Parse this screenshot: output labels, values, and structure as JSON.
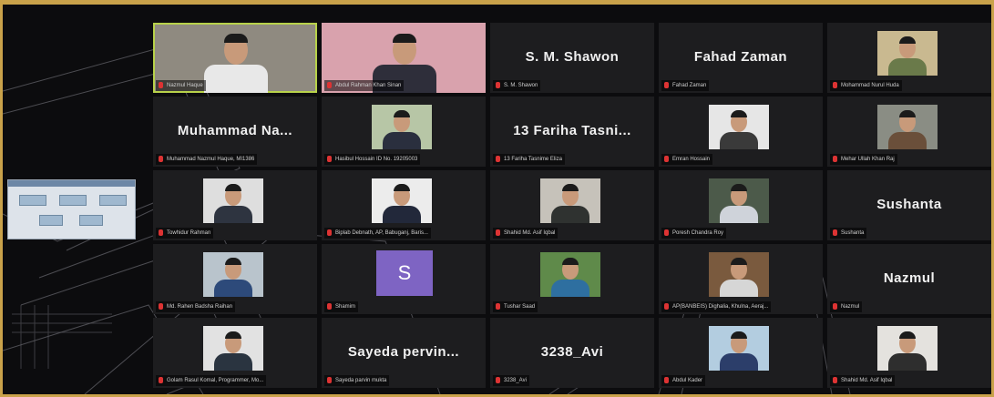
{
  "colors": {
    "frame_border": "#c9a24a",
    "background": "#0c0c0e",
    "tile": "#1d1d1f",
    "active_speaker": "#b8d24a",
    "muted": "#dd3333",
    "avatar": "#7e64c3"
  },
  "icons": {
    "mic_muted": "mic-off-icon"
  },
  "tiles": [
    {
      "kind": "video",
      "label": "Nazmul Haque",
      "bg": "#8f8a80",
      "shirt": "#e8e8e8"
    },
    {
      "kind": "video",
      "label": "Abdul Rahman Khan Sinan",
      "bg": "#d9a2ad",
      "shirt": "#2e2e3a"
    },
    {
      "kind": "name",
      "display": "S. M. Shawon",
      "label": "S. M. Shawon"
    },
    {
      "kind": "name",
      "display": "Fahad Zaman",
      "label": "Fahad Zaman"
    },
    {
      "kind": "photo",
      "label": "Mohammad Nurul Huda",
      "bg": "#c9b990",
      "shirt": "#6a7a4a"
    },
    {
      "kind": "name",
      "display": "Muhammad Na...",
      "label": "Muhammad Nazmul Haque, MI1386"
    },
    {
      "kind": "photo",
      "label": "Hasibul Hossain ID No. 19205003",
      "bg": "#b7c6a6",
      "shirt": "#2a2f3e"
    },
    {
      "kind": "name",
      "display": "13 Fariha Tasni...",
      "label": "13 Fariha Tasnime Eliza"
    },
    {
      "kind": "photo",
      "label": "Emran Hossain",
      "bg": "#e6e6e6",
      "shirt": "#3a3a3a"
    },
    {
      "kind": "photo",
      "label": "Mehar Ullah Khan Raj",
      "bg": "#8a8d84",
      "shirt": "#6a4f3a"
    },
    {
      "kind": "photo",
      "label": "Towhidur Rahman",
      "bg": "#dedede",
      "shirt": "#2e3440"
    },
    {
      "kind": "photo",
      "label": "Biplab Debnath, AP, Babuganj, Baris...",
      "bg": "#ececec",
      "shirt": "#22283a"
    },
    {
      "kind": "photo",
      "label": "Shahid Md. Asif Iqbal",
      "bg": "#c6c2ba",
      "shirt": "#2f3230"
    },
    {
      "kind": "photo",
      "label": "Poresh Chandra Roy",
      "bg": "#4c5a4a",
      "shirt": "#cfd3da"
    },
    {
      "kind": "name",
      "display": "Sushanta",
      "label": "Sushanta"
    },
    {
      "kind": "photo",
      "label": "Md. Rahen Badsha Raihan",
      "bg": "#b9c4cc",
      "shirt": "#2d4a7a"
    },
    {
      "kind": "avatar",
      "display": "S",
      "label": "Shamim"
    },
    {
      "kind": "photo",
      "label": "Tushar Saad",
      "bg": "#5f8a4a",
      "shirt": "#2e6fa0"
    },
    {
      "kind": "photo",
      "label": "AP(BANBEIS) Dighalia, Khulna, Aeraj...",
      "bg": "#7a5a3e",
      "shirt": "#d6d6d6"
    },
    {
      "kind": "name",
      "display": "Nazmul",
      "label": "Nazmul"
    },
    {
      "kind": "photo",
      "label": "Golam Rasul Komal, Programmer, Mo...",
      "bg": "#e2e2e2",
      "shirt": "#2a3440"
    },
    {
      "kind": "name",
      "display": "Sayeda pervin...",
      "label": "Sayeda parvin mukta"
    },
    {
      "kind": "name",
      "display": "3238_Avi",
      "label": "3238_Avi"
    },
    {
      "kind": "photo",
      "label": "Abdul Kader",
      "bg": "#b3cde0",
      "shirt": "#2c3e6a"
    },
    {
      "kind": "photo",
      "label": "Shahid Md. Asif Iqbal",
      "bg": "#e4e2de",
      "shirt": "#2e2e2e"
    }
  ]
}
